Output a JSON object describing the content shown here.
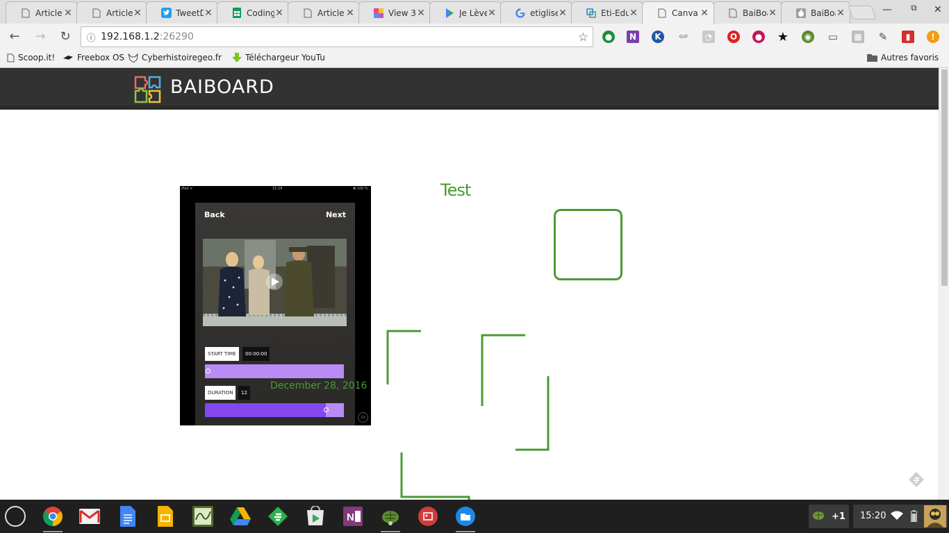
{
  "browser": {
    "tabs": [
      {
        "title": "Article",
        "icon": "doc-icon"
      },
      {
        "title": "Article",
        "icon": "doc-icon"
      },
      {
        "title": "TweetD",
        "icon": "twitter-icon"
      },
      {
        "title": "Coding",
        "icon": "sheets-icon"
      },
      {
        "title": "Article",
        "icon": "doc-icon"
      },
      {
        "title": "View 3",
        "icon": "view3-icon"
      },
      {
        "title": "Je Lève",
        "icon": "play-store-icon"
      },
      {
        "title": "etiglise",
        "icon": "google-icon"
      },
      {
        "title": "Eti-Edu",
        "icon": "eti-edu-icon"
      },
      {
        "title": "Canva",
        "icon": "doc-icon",
        "active": true
      },
      {
        "title": "BaiBoa",
        "icon": "doc-icon"
      },
      {
        "title": "BaiBoa",
        "icon": "apple-icon"
      }
    ],
    "address": {
      "host": "192.168.1.2",
      "port": ":26290"
    },
    "bookmarks": [
      {
        "label": "Scoop.it!",
        "icon": "doc-icon"
      },
      {
        "label": "Freebox OS",
        "icon": "freebox-icon"
      },
      {
        "label": "Cyberhistoiregeo.fr : r",
        "icon": "wolf-icon"
      },
      {
        "label": "Téléchargeur YouTub",
        "icon": "download-arrow-icon"
      }
    ],
    "other_bookmarks": "Autres favoris",
    "colors": {
      "tabstrip": "#dedede",
      "toolbar": "#f2f2f2"
    }
  },
  "site": {
    "brand": "BAIBOARD",
    "header_color": "#323232",
    "accent_green": "#4a9a34"
  },
  "board": {
    "test_label": "Test",
    "date_label": "December 28, 2016",
    "ipad": {
      "status_left": "iPad ᯤ",
      "status_time": "15:28",
      "status_right": "✱ 100 %",
      "back": "Back",
      "next": "Next",
      "start_time_label": "START TIME",
      "start_time_value": "00:00:00",
      "duration_label": "DURATION",
      "duration_value": "12",
      "speed": "1X",
      "start_slider": 0.02,
      "duration_slider": 0.87,
      "bar_light": "#b98cf5",
      "bar_dark": "#8447f0"
    }
  },
  "shelf": {
    "apps": [
      {
        "name": "chrome-icon"
      },
      {
        "name": "gmail-icon"
      },
      {
        "name": "docs-icon"
      },
      {
        "name": "slides-icon"
      },
      {
        "name": "graph-app-icon"
      },
      {
        "name": "drive-icon"
      },
      {
        "name": "feedly-icon"
      },
      {
        "name": "play-store-icon"
      },
      {
        "name": "onenote-icon"
      },
      {
        "name": "turtle-icon"
      },
      {
        "name": "photos-icon"
      },
      {
        "name": "files-icon"
      }
    ],
    "notification_count": "+1",
    "clock": "15:20"
  }
}
